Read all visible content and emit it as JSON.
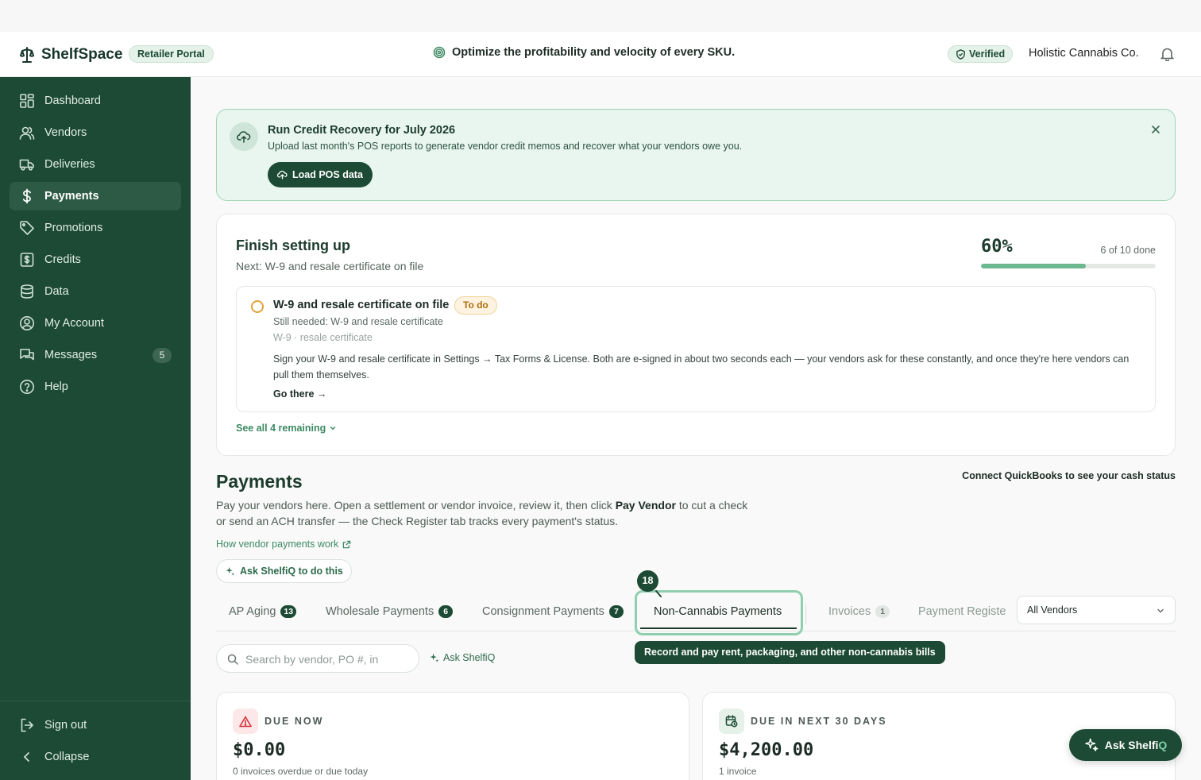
{
  "app": {
    "name": "ShelfSpace",
    "portal": "Retailer Portal",
    "tagline": "Optimize the profitability and velocity of every SKU.",
    "verified": "Verified",
    "org": "Holistic Cannabis Co."
  },
  "sidebar": {
    "items": [
      {
        "label": "Dashboard",
        "icon": "dashboard-icon"
      },
      {
        "label": "Vendors",
        "icon": "users-icon"
      },
      {
        "label": "Deliveries",
        "icon": "truck-icon"
      },
      {
        "label": "Payments",
        "icon": "dollar-icon",
        "active": true
      },
      {
        "label": "Promotions",
        "icon": "tag-icon"
      },
      {
        "label": "Credits",
        "icon": "credit-icon"
      },
      {
        "label": "Data",
        "icon": "database-icon"
      },
      {
        "label": "My Account",
        "icon": "account-icon"
      },
      {
        "label": "Messages",
        "icon": "messages-icon",
        "badge": "5"
      },
      {
        "label": "Help",
        "icon": "help-icon"
      }
    ],
    "signout": "Sign out",
    "collapse": "Collapse"
  },
  "banner": {
    "title": "Run Credit Recovery for July 2026",
    "subtitle": "Upload last month's POS reports to generate vendor credit memos and recover what your vendors owe you.",
    "button": "Load POS data"
  },
  "setup": {
    "title": "Finish setting up",
    "next": "Next: W-9 and resale certificate on file",
    "percent_label": "60%",
    "progress": 0.6,
    "count": "6 of 10 done",
    "task": {
      "title": "W-9 and resale certificate on file",
      "status": "To do",
      "needed": "Still needed: W-9 and resale certificate",
      "tags": "W-9 · resale certificate",
      "description": "Sign your W-9 and resale certificate in Settings → Tax Forms & License. Both are e-signed in about two seconds each — your vendors ask for these constantly, and once they're here vendors can pull them themselves.",
      "go": "Go there →"
    },
    "see_all": "See all 4 remaining"
  },
  "payments": {
    "title": "Payments",
    "qb_link": "Connect QuickBooks to see your cash status",
    "desc_before": "Pay your vendors here. Open a settlement or vendor invoice, review it, then click ",
    "desc_bold": "Pay Vendor",
    "desc_after": " to cut a check or send an ACH transfer — the Check Register tab tracks every payment's status.",
    "how_link": "How vendor payments work",
    "ask_pill": "Ask ShelfiQ to do this"
  },
  "tabs": {
    "items": [
      {
        "label": "AP Aging",
        "count": "13"
      },
      {
        "label": "Wholesale Payments",
        "count": "6"
      },
      {
        "label": "Consignment Payments",
        "count": "7"
      },
      {
        "label": "Non-Cannabis Payments",
        "count": "",
        "active": true
      },
      {
        "label": "Invoices",
        "count": "1"
      },
      {
        "label": "Payment Registe",
        "count": ""
      }
    ],
    "step_number": "18",
    "tooltip": "Record and pay rent, packaging, and other non-cannabis bills",
    "vendor_filter": "All Vendors"
  },
  "filters": {
    "search_placeholder": "Search by vendor, PO #, in",
    "ask": "Ask ShelfiQ"
  },
  "cards": [
    {
      "label": "DUE NOW",
      "amount": "$0.00",
      "sub": "0 invoices overdue or due today",
      "icon": "alert-icon"
    },
    {
      "label": "DUE IN NEXT 30 DAYS",
      "amount": "$4,200.00",
      "sub": "1 invoice",
      "icon": "calendar-clock-icon"
    }
  ],
  "fab": {
    "label_main": "Ask Shelfi",
    "label_accent": "Q"
  },
  "colors": {
    "sidebar": "#1c4a34",
    "accent": "#3d8a63",
    "banner_bg": "#e8f6ef",
    "warning": "#e2a23a",
    "danger": "#d6323a"
  }
}
